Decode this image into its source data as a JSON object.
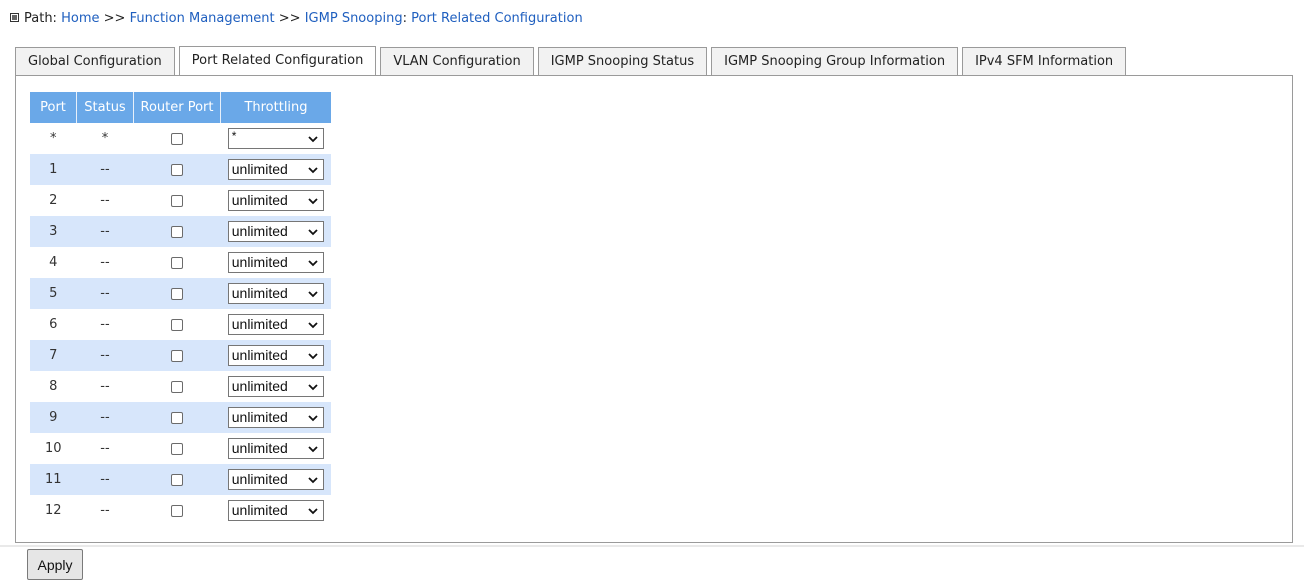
{
  "breadcrumb": {
    "label": "Path:",
    "home": "Home",
    "sep1": ">>",
    "function_management": "Function Management",
    "sep2": ">>",
    "igmp_snooping": "IGMP Snooping",
    "sep3": ":",
    "current": "Port Related Configuration"
  },
  "tabs": [
    {
      "label": "Global Configuration"
    },
    {
      "label": "Port Related Configuration",
      "active": true
    },
    {
      "label": "VLAN Configuration"
    },
    {
      "label": "IGMP Snooping Status"
    },
    {
      "label": "IGMP Snooping Group Information"
    },
    {
      "label": "IPv4 SFM Information"
    }
  ],
  "table": {
    "headers": {
      "port": "Port",
      "status": "Status",
      "router_port": "Router Port",
      "throttling": "Throttling"
    },
    "header_color": "#6aa8e8",
    "stripe_color": "#d7e6fb",
    "rows": [
      {
        "port": "*",
        "status": "*",
        "router_port": false,
        "throttling": "*"
      },
      {
        "port": "1",
        "status": "--",
        "router_port": false,
        "throttling": "unlimited"
      },
      {
        "port": "2",
        "status": "--",
        "router_port": false,
        "throttling": "unlimited"
      },
      {
        "port": "3",
        "status": "--",
        "router_port": false,
        "throttling": "unlimited"
      },
      {
        "port": "4",
        "status": "--",
        "router_port": false,
        "throttling": "unlimited"
      },
      {
        "port": "5",
        "status": "--",
        "router_port": false,
        "throttling": "unlimited"
      },
      {
        "port": "6",
        "status": "--",
        "router_port": false,
        "throttling": "unlimited"
      },
      {
        "port": "7",
        "status": "--",
        "router_port": false,
        "throttling": "unlimited"
      },
      {
        "port": "8",
        "status": "--",
        "router_port": false,
        "throttling": "unlimited"
      },
      {
        "port": "9",
        "status": "--",
        "router_port": false,
        "throttling": "unlimited"
      },
      {
        "port": "10",
        "status": "--",
        "router_port": false,
        "throttling": "unlimited"
      },
      {
        "port": "11",
        "status": "--",
        "router_port": false,
        "throttling": "unlimited"
      },
      {
        "port": "12",
        "status": "--",
        "router_port": false,
        "throttling": "unlimited"
      }
    ]
  },
  "apply_label": "Apply",
  "icons": {
    "path_icon": "square-bullet-icon",
    "select_chevron": "chevron-down-icon",
    "checkbox": "checkbox-icon"
  }
}
